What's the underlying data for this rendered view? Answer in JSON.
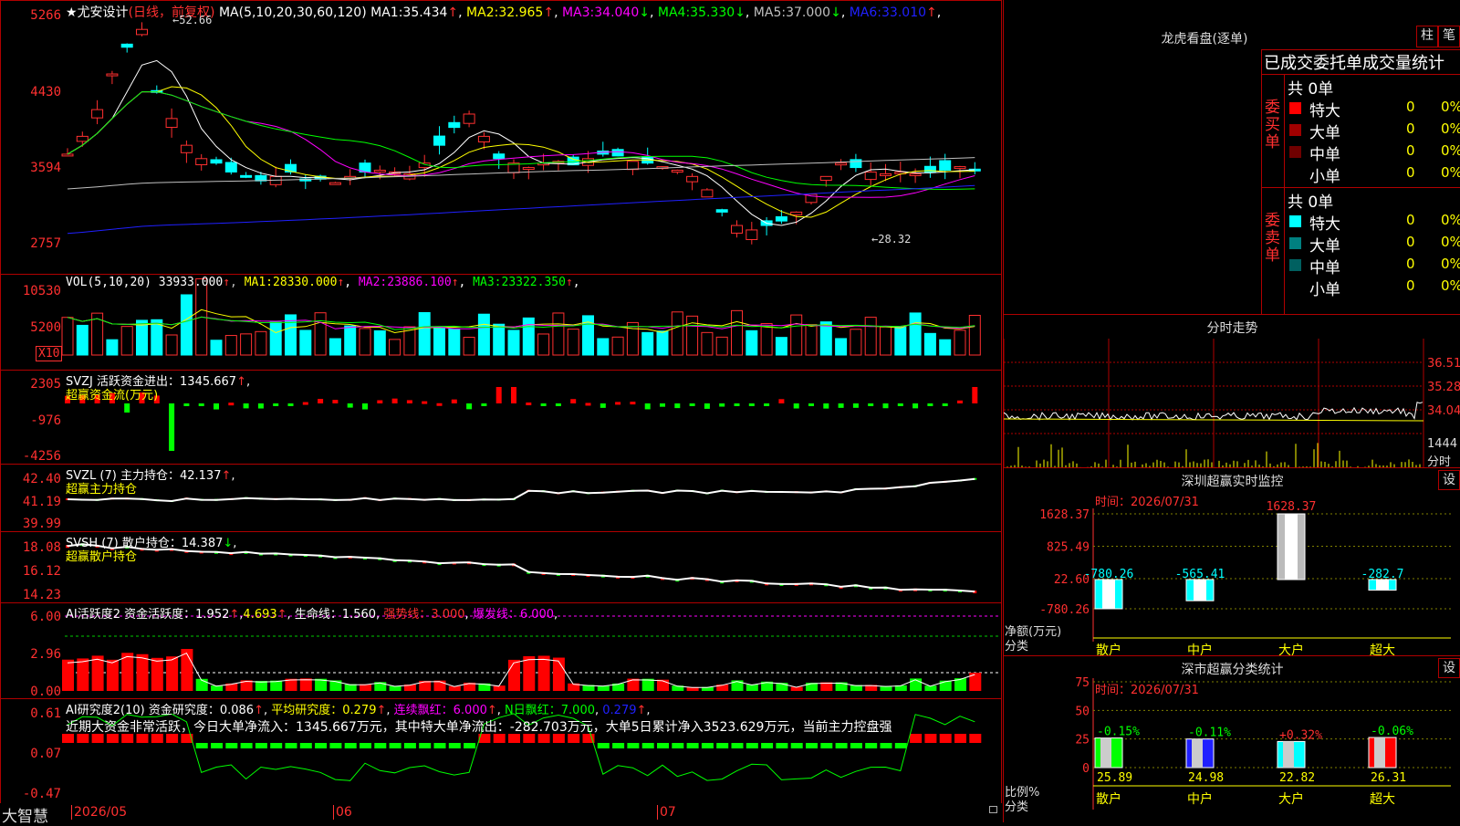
{
  "main": {
    "stock_name": "尤安设计",
    "period": "(日线，前复权)",
    "ma_header": "MA(5,10,20,30,60,120)",
    "ma": [
      {
        "label": "MA1:",
        "value": "35.434",
        "arrow": "↑",
        "color": "#ffffff"
      },
      {
        "label": "MA2:",
        "value": "32.965",
        "arrow": "↑",
        "color": "#ffff00"
      },
      {
        "label": "MA3:",
        "value": "34.040",
        "arrow": "↓",
        "color": "#ff00ff"
      },
      {
        "label": "MA4:",
        "value": "35.330",
        "arrow": "↓",
        "color": "#00ff00"
      },
      {
        "label": "MA5:",
        "value": "37.000",
        "arrow": "↓",
        "color": "#c0c0c0"
      },
      {
        "label": "MA6:",
        "value": "33.010",
        "arrow": "↑",
        "color": "#2020ff"
      }
    ],
    "y_ticks": [
      "5266",
      "4430",
      "3594",
      "2757"
    ],
    "high_label": "52.66",
    "low_label": "28.32"
  },
  "vol": {
    "title": "VOL(5,10,20)",
    "value": "33933.000",
    "items": [
      {
        "label": "MA1:",
        "value": "28330.000",
        "arrow": "↑",
        "color": "#ffff00"
      },
      {
        "label": "MA2:",
        "value": "23886.100",
        "arrow": "↑",
        "color": "#ff00ff"
      },
      {
        "label": "MA3:",
        "value": "23322.350",
        "arrow": "↑",
        "color": "#00ff00"
      }
    ],
    "y_ticks": [
      "10530",
      "5200"
    ],
    "unit_badge": "X10"
  },
  "svzj": {
    "title": "SVZJ",
    "text": "活跃资金进出：1345.667",
    "arrow": "↑",
    "subtitle": "超赢资金流(万元)",
    "y_ticks": [
      "2305",
      "-976",
      "-4256"
    ]
  },
  "svzl": {
    "title": "SVZL (7)",
    "text": "主力持仓：42.137",
    "arrow": "↑",
    "subtitle": "超赢主力持仓",
    "y_ticks": [
      "42.40",
      "41.19",
      "39.99"
    ]
  },
  "svsh": {
    "title": "SVSH (7)",
    "text": "散户持仓：14.387",
    "arrow": "↓",
    "subtitle": "超赢散户持仓",
    "y_ticks": [
      "18.08",
      "16.12",
      "14.23"
    ]
  },
  "ai1": {
    "title": "AI活跃度2",
    "a_label": "资金活跃度：",
    "a_value": "1.952",
    "b_value": "4.693",
    "c_label": "生命线：",
    "c_value": "1.560",
    "d_label": "强势线：",
    "d_value": "3.000",
    "e_label": "爆发线：",
    "e_value": "6.000",
    "y_ticks": [
      "6.00",
      "2.96",
      "0.00"
    ]
  },
  "ai2": {
    "title": "AI研究度2(10)",
    "a_label": "资金研究度：",
    "a_value": "0.086",
    "b_label": "平均研究度：",
    "b_value": "0.279",
    "c_label": "连续飘红：",
    "c_value": "6.000",
    "d_label": "N日飘红：",
    "d_value": "7.000",
    "e_value": "0.279",
    "summary": "近期大资金非常活跃，今日大单净流入：1345.667万元，其中特大单净流出：-282.703万元，大单5日累计净入3523.629万元，当前主力控盘强",
    "y_ticks": [
      "0.61",
      "0.07",
      "-0.47"
    ]
  },
  "xaxis": {
    "brand": "大智慧",
    "labels": [
      "2026/05",
      "06",
      "07"
    ]
  },
  "dragon": {
    "title": "龙虎看盘(逐单)",
    "btn1": "柱",
    "btn2": "笔",
    "subtitle": "已成交委托单成交量统计",
    "buy_label": "委买单",
    "sell_label": "委卖单",
    "buy_total": "共 0单",
    "sell_total": "共 0单",
    "buy_rows": [
      {
        "name": "特大",
        "count": "0",
        "pct": "0%",
        "color": "#ff0000"
      },
      {
        "name": "大单",
        "count": "0",
        "pct": "0%",
        "color": "#a00000"
      },
      {
        "name": "中单",
        "count": "0",
        "pct": "0%",
        "color": "#700000"
      },
      {
        "name": "小单",
        "count": "0",
        "pct": "0%",
        "color": ""
      }
    ],
    "sell_rows": [
      {
        "name": "特大",
        "count": "0",
        "pct": "0%",
        "color": "#00ffff"
      },
      {
        "name": "大单",
        "count": "0",
        "pct": "0%",
        "color": "#008080"
      },
      {
        "name": "中单",
        "count": "0",
        "pct": "0%",
        "color": "#006060"
      },
      {
        "name": "小单",
        "count": "0",
        "pct": "0%",
        "color": ""
      }
    ]
  },
  "minute": {
    "title": "分时走势",
    "y_ticks": [
      "36.51",
      "35.28",
      "34.04"
    ],
    "vol_label": "1444",
    "vol_unit": "分时"
  },
  "monitor": {
    "title": "深圳超赢实时监控",
    "btn": "设",
    "time": "时间：2026/07/31",
    "y_ticks": [
      "1628.37",
      "825.49",
      "22.60",
      "-780.26"
    ],
    "axis_title": "净额(万元)",
    "axis_sub": "分类",
    "chart_data": {
      "type": "bar",
      "categories": [
        "散户",
        "中户",
        "大户",
        "超大"
      ],
      "values": [
        -780.26,
        -565.41,
        1628.37,
        -282.7
      ],
      "value_labels": [
        "-780.26",
        "-565.41",
        "1628.37",
        "-282.7"
      ]
    }
  },
  "classify": {
    "title": "深市超赢分类统计",
    "btn": "设",
    "time": "时间：2026/07/31",
    "y_ticks": [
      "75",
      "50",
      "25",
      "0"
    ],
    "axis_title": "比例%",
    "axis_sub": "分类",
    "chart_data": {
      "type": "bar",
      "categories": [
        "散户",
        "中户",
        "大户",
        "超大"
      ],
      "values": [
        25.89,
        24.98,
        22.82,
        26.31
      ],
      "changes": [
        "-0.15%",
        "-0.11%",
        "+0.32%",
        "-0.06%"
      ],
      "colors": [
        "#00ff00",
        "#2020ff",
        "#00ffff",
        "#ff0000"
      ]
    }
  }
}
